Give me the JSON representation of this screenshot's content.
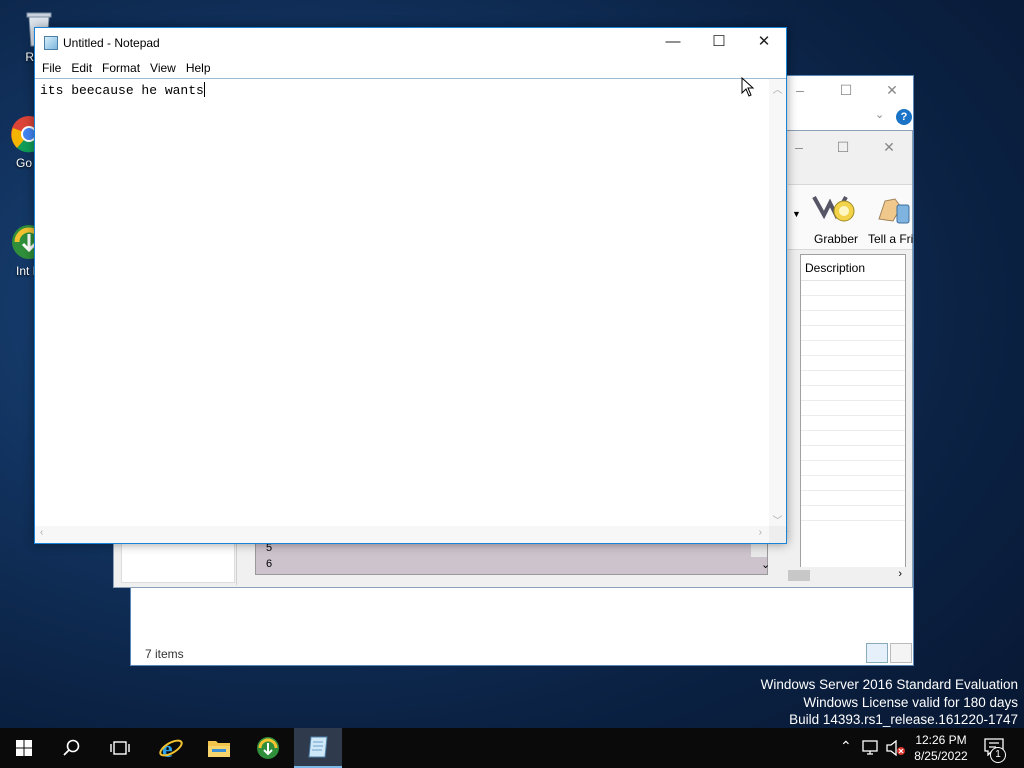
{
  "desktop": {
    "icons": [
      {
        "label": "Recy",
        "icon": "recycle-bin-icon"
      },
      {
        "label": "Go Ch",
        "icon": "chrome-icon"
      },
      {
        "label": "Int Dov",
        "icon": "internet-download-manager-icon"
      }
    ]
  },
  "explorer": {
    "status": "7 items"
  },
  "dialog": {
    "toolbar": [
      {
        "label": "Grabber",
        "icon": "grabber-icon"
      },
      {
        "label": "Tell a Fri",
        "icon": "tell-a-friend-icon"
      }
    ],
    "column_header": "Description",
    "list_items": [
      "5",
      "6"
    ]
  },
  "notepad": {
    "title": "Untitled - Notepad",
    "menu": [
      "File",
      "Edit",
      "Format",
      "View",
      "Help"
    ],
    "content": "its beecause he wants"
  },
  "watermark": {
    "line1": "Windows Server 2016 Standard Evaluation",
    "line2": "Windows License valid for 180 days",
    "line3": "Build 14393.rs1_release.161220-1747"
  },
  "taskbar": {
    "time": "12:26 PM",
    "date": "8/25/2022",
    "notification_count": "1"
  }
}
